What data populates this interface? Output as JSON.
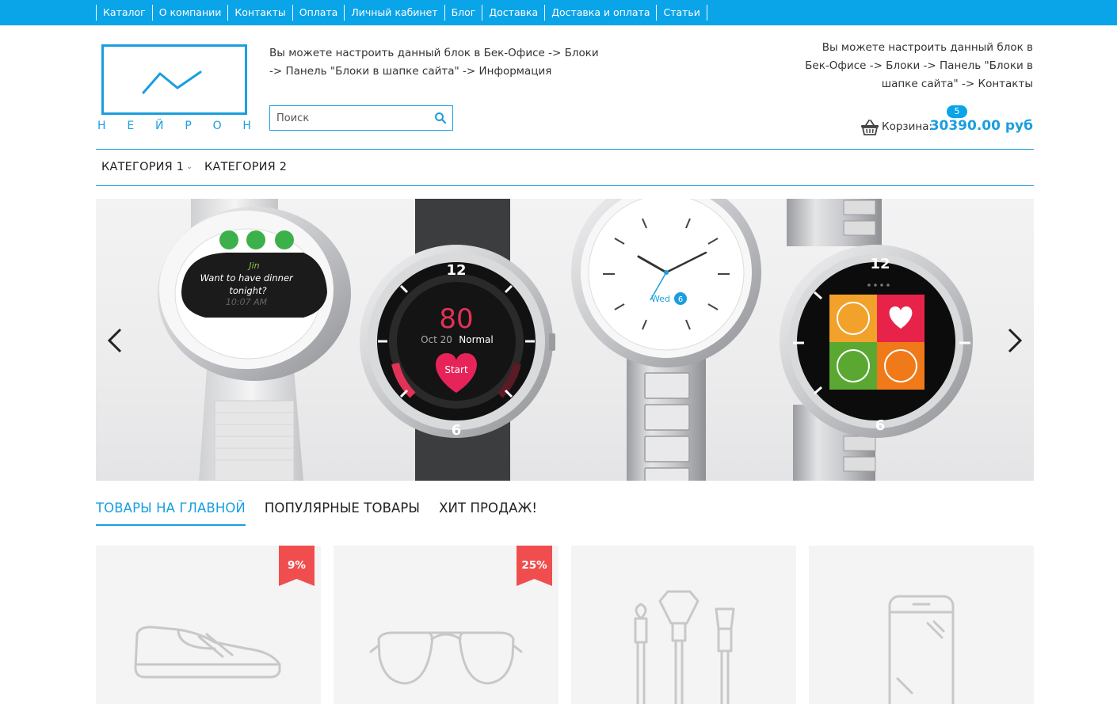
{
  "top_nav": {
    "items": [
      {
        "label": "Каталог"
      },
      {
        "label": "О компании"
      },
      {
        "label": "Контакты"
      },
      {
        "label": "Оплата"
      },
      {
        "label": "Личный кабинет"
      },
      {
        "label": "Блог"
      },
      {
        "label": "Доставка"
      },
      {
        "label": "Доставка и оплата"
      },
      {
        "label": "Статьи"
      }
    ]
  },
  "logo": {
    "letters": [
      "Н",
      "Е",
      "Й",
      "Р",
      "О",
      "Н"
    ]
  },
  "header": {
    "info_center": "Вы можете настроить данный блок в Бек-Офисе -> Блоки -> Панель \"Блоки в шапке сайта\" -> Информация",
    "info_right": "Вы можете настроить данный блок в Бек-Офисе -> Блоки -> Панель \"Блоки в шапке сайта\" -> Контакты"
  },
  "search": {
    "placeholder": "Поиск"
  },
  "cart": {
    "count": "5",
    "label": "Корзина:",
    "total": "30390.00 руб"
  },
  "categories": {
    "cat1": "КАТЕГОРИЯ 1",
    "cat2": "КАТЕГОРИЯ 2"
  },
  "slider": {
    "watch1": {
      "name": "Jin",
      "message": "Want to have dinner tonight?",
      "time": "10:07 AM"
    },
    "watch2": {
      "value": "80",
      "date": "Oct 20",
      "status": "Normal",
      "button": "Start",
      "num12": "12",
      "num6": "6"
    },
    "watch3": {
      "day": "Wed",
      "date": "6"
    },
    "watch4": {
      "num12": "12",
      "num6": "6"
    }
  },
  "tabs": [
    {
      "label": "ТОВАРЫ НА ГЛАВНОЙ",
      "active": true
    },
    {
      "label": "ПОПУЛЯРНЫЕ ТОВАРЫ",
      "active": false
    },
    {
      "label": "ХИТ ПРОДАЖ!",
      "active": false
    }
  ],
  "products": [
    {
      "icon": "shoe-icon",
      "discount": "9%"
    },
    {
      "icon": "sunglasses-icon",
      "discount": "25%"
    },
    {
      "icon": "makeup-brushes-icon",
      "discount": ""
    },
    {
      "icon": "smartphone-icon",
      "discount": ""
    }
  ],
  "colors": {
    "accent": "#0aa4e8",
    "brand_blue": "#1a9ee0",
    "badge_red": "#f04e4e",
    "card_bg": "#f4f4f4"
  }
}
